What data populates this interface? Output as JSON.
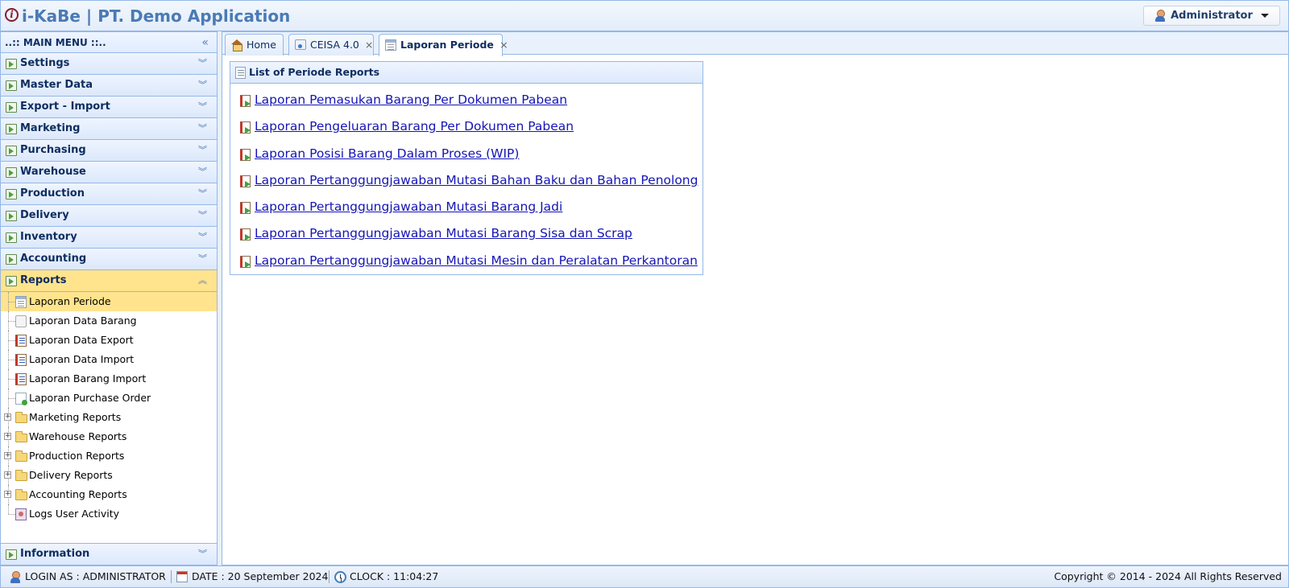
{
  "header": {
    "app_title": "i-KaBe | PT. Demo Application",
    "user_label": "Administrator"
  },
  "sidebar": {
    "menu_title": "..:: MAIN MENU ::..",
    "sections": [
      {
        "label": "Settings"
      },
      {
        "label": "Master Data"
      },
      {
        "label": "Export - Import"
      },
      {
        "label": "Marketing"
      },
      {
        "label": "Purchasing"
      },
      {
        "label": "Warehouse"
      },
      {
        "label": "Production"
      },
      {
        "label": "Delivery"
      },
      {
        "label": "Inventory"
      },
      {
        "label": "Accounting"
      },
      {
        "label": "Reports"
      }
    ],
    "reports_items": [
      {
        "label": "Laporan Periode",
        "selected": true
      },
      {
        "label": "Laporan Data Barang"
      },
      {
        "label": "Laporan Data Export"
      },
      {
        "label": "Laporan Data Import"
      },
      {
        "label": "Laporan Barang Import"
      },
      {
        "label": "Laporan Purchase Order"
      },
      {
        "label": "Marketing Reports"
      },
      {
        "label": "Warehouse Reports"
      },
      {
        "label": "Production Reports"
      },
      {
        "label": "Delivery Reports"
      },
      {
        "label": "Accounting Reports"
      },
      {
        "label": "Logs User Activity"
      }
    ],
    "information_label": "Information"
  },
  "tabs": [
    {
      "label": "Home"
    },
    {
      "label": "CEISA 4.0"
    },
    {
      "label": "Laporan Periode"
    }
  ],
  "panel": {
    "title": "List of Periode Reports",
    "links": [
      "Laporan Pemasukan Barang Per Dokumen Pabean",
      "Laporan Pengeluaran Barang Per Dokumen Pabean",
      "Laporan Posisi Barang Dalam Proses (WIP)",
      "Laporan Pertanggungjawaban Mutasi Bahan Baku dan Bahan Penolong",
      "Laporan Pertanggungjawaban Mutasi Barang Jadi",
      "Laporan Pertanggungjawaban Mutasi Barang Sisa dan Scrap",
      "Laporan Pertanggungjawaban Mutasi Mesin dan Peralatan Perkantoran"
    ]
  },
  "statusbar": {
    "login": "LOGIN AS : ADMINISTRATOR",
    "date": "DATE : 20 September 2024",
    "clock": "CLOCK : 11:04:27",
    "copyright": "Copyright © 2014 - 2024 All Rights Reserved"
  },
  "colors": {
    "accent": "#95b8e7",
    "active": "#ffe48d",
    "link": "#1515b5"
  }
}
